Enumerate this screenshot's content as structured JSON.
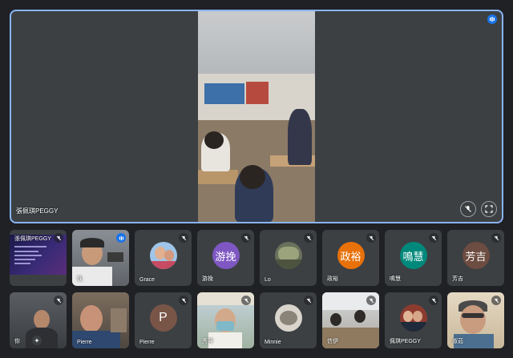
{
  "main": {
    "speaker_name": "張佩琪PEGGY",
    "controls": {
      "mute_icon": "mic-off-icon",
      "fullscreen_icon": "fullscreen-icon"
    }
  },
  "row1": [
    {
      "name": "張佩琪PEGGY",
      "type": "presentation",
      "muted": true
    },
    {
      "name": "挽",
      "type": "camera",
      "speaking": true
    },
    {
      "name": "Grace",
      "type": "photo-avatar",
      "muted": true
    },
    {
      "name": "游挽",
      "type": "text-avatar",
      "avatar_text": "游挽",
      "color": "#7e57c2",
      "muted": true
    },
    {
      "name": "Lo",
      "type": "photo-avatar",
      "muted": true
    },
    {
      "name": "政裕",
      "type": "text-avatar",
      "avatar_text": "政裕",
      "color": "#e8710a",
      "muted": true
    },
    {
      "name": "鳴慧",
      "type": "text-avatar",
      "avatar_text": "鳴慧",
      "color": "#00897b",
      "muted": true
    },
    {
      "name": "芳吉",
      "type": "text-avatar",
      "avatar_text": "芳吉",
      "color": "#6d4c41",
      "muted": true
    }
  ],
  "row2": [
    {
      "name": "你",
      "type": "camera",
      "muted": true
    },
    {
      "name": "Pierre",
      "type": "camera"
    },
    {
      "name": "Pierre",
      "type": "text-avatar",
      "avatar_text": "P",
      "color": "#795548",
      "muted": true
    },
    {
      "name": "秀萍",
      "type": "camera",
      "muted": true
    },
    {
      "name": "Minnie",
      "type": "photo-avatar",
      "muted": true
    },
    {
      "name": "信伊",
      "type": "camera",
      "muted": true
    },
    {
      "name": "佩琪PEGGY",
      "type": "photo-avatar",
      "muted": true
    },
    {
      "name": "淑茹",
      "type": "camera",
      "muted": true
    }
  ],
  "colors": {
    "background": "#202124",
    "tile": "#3c4043",
    "active_border": "#8ab4f8",
    "accent": "#1a73e8"
  }
}
